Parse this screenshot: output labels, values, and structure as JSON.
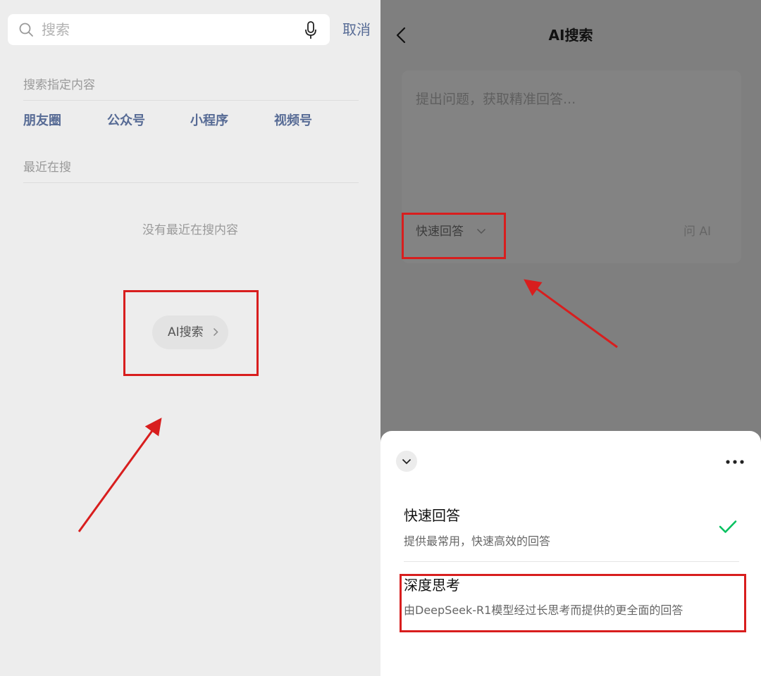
{
  "left": {
    "search": {
      "placeholder": "搜索",
      "cancel_label": "取消"
    },
    "specified": {
      "title": "搜索指定内容",
      "categories": [
        "朋友圈",
        "公众号",
        "小程序",
        "视频号"
      ]
    },
    "recent": {
      "title": "最近在搜",
      "empty_text": "没有最近在搜内容"
    },
    "ai_search_button": {
      "label": "AI搜索"
    }
  },
  "right": {
    "header": {
      "title": "AI搜索"
    },
    "ask_card": {
      "placeholder": "提出问题，获取精准回答...",
      "mode_label": "快速回答",
      "ask_button": "问 AI"
    },
    "mode_sheet": {
      "options": [
        {
          "title": "快速回答",
          "desc": "提供最常用，快速高效的回答",
          "selected": true
        },
        {
          "title": "深度思考",
          "desc": "由DeepSeek-R1模型经过长思考而提供的更全面的回答",
          "selected": false
        }
      ]
    }
  },
  "colors": {
    "link": "#576b95",
    "highlight": "#d81e1e",
    "check": "#07c160",
    "overlay": "#7f7f7f"
  },
  "icons": [
    "search-icon",
    "mic-icon",
    "chevron-right-icon",
    "back-icon",
    "chevron-down-icon",
    "more-icon",
    "check-icon"
  ]
}
